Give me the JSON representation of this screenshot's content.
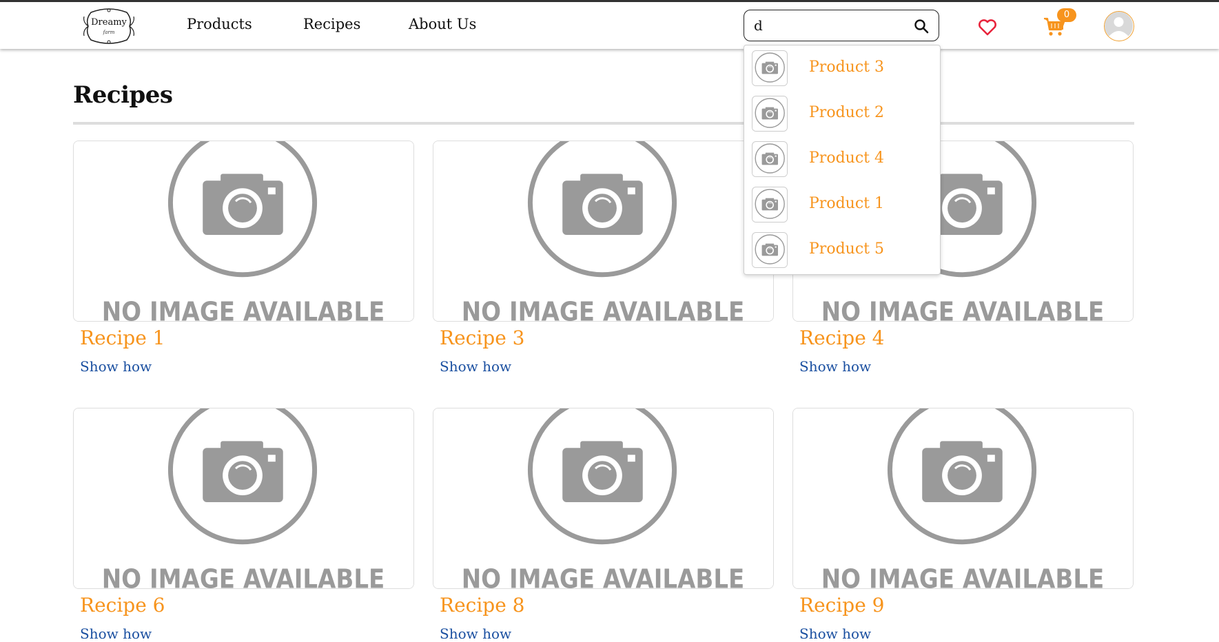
{
  "brand": {
    "name": "Dreamy",
    "tagline": "farm"
  },
  "nav": {
    "items": [
      {
        "label": "Products"
      },
      {
        "label": "Recipes"
      },
      {
        "label": "About Us"
      }
    ]
  },
  "search": {
    "value": "d"
  },
  "cart": {
    "count": "0"
  },
  "colors": {
    "accent": "#f7941d",
    "link": "#1a4fa0",
    "heart": "#e8243c"
  },
  "page": {
    "title": "Recipes"
  },
  "placeholder_image": {
    "text": "NO IMAGE AVAILABLE"
  },
  "recipes": [
    {
      "title": "Recipe 1",
      "link": "Show how"
    },
    {
      "title": "Recipe 3",
      "link": "Show how"
    },
    {
      "title": "Recipe 4",
      "link": "Show how"
    },
    {
      "title": "Recipe 6",
      "link": "Show how"
    },
    {
      "title": "Recipe 8",
      "link": "Show how"
    },
    {
      "title": "Recipe 9",
      "link": "Show how"
    }
  ],
  "search_results": [
    {
      "label": "Product 3"
    },
    {
      "label": "Product 2"
    },
    {
      "label": "Product 4"
    },
    {
      "label": "Product 1"
    },
    {
      "label": "Product 5"
    }
  ]
}
